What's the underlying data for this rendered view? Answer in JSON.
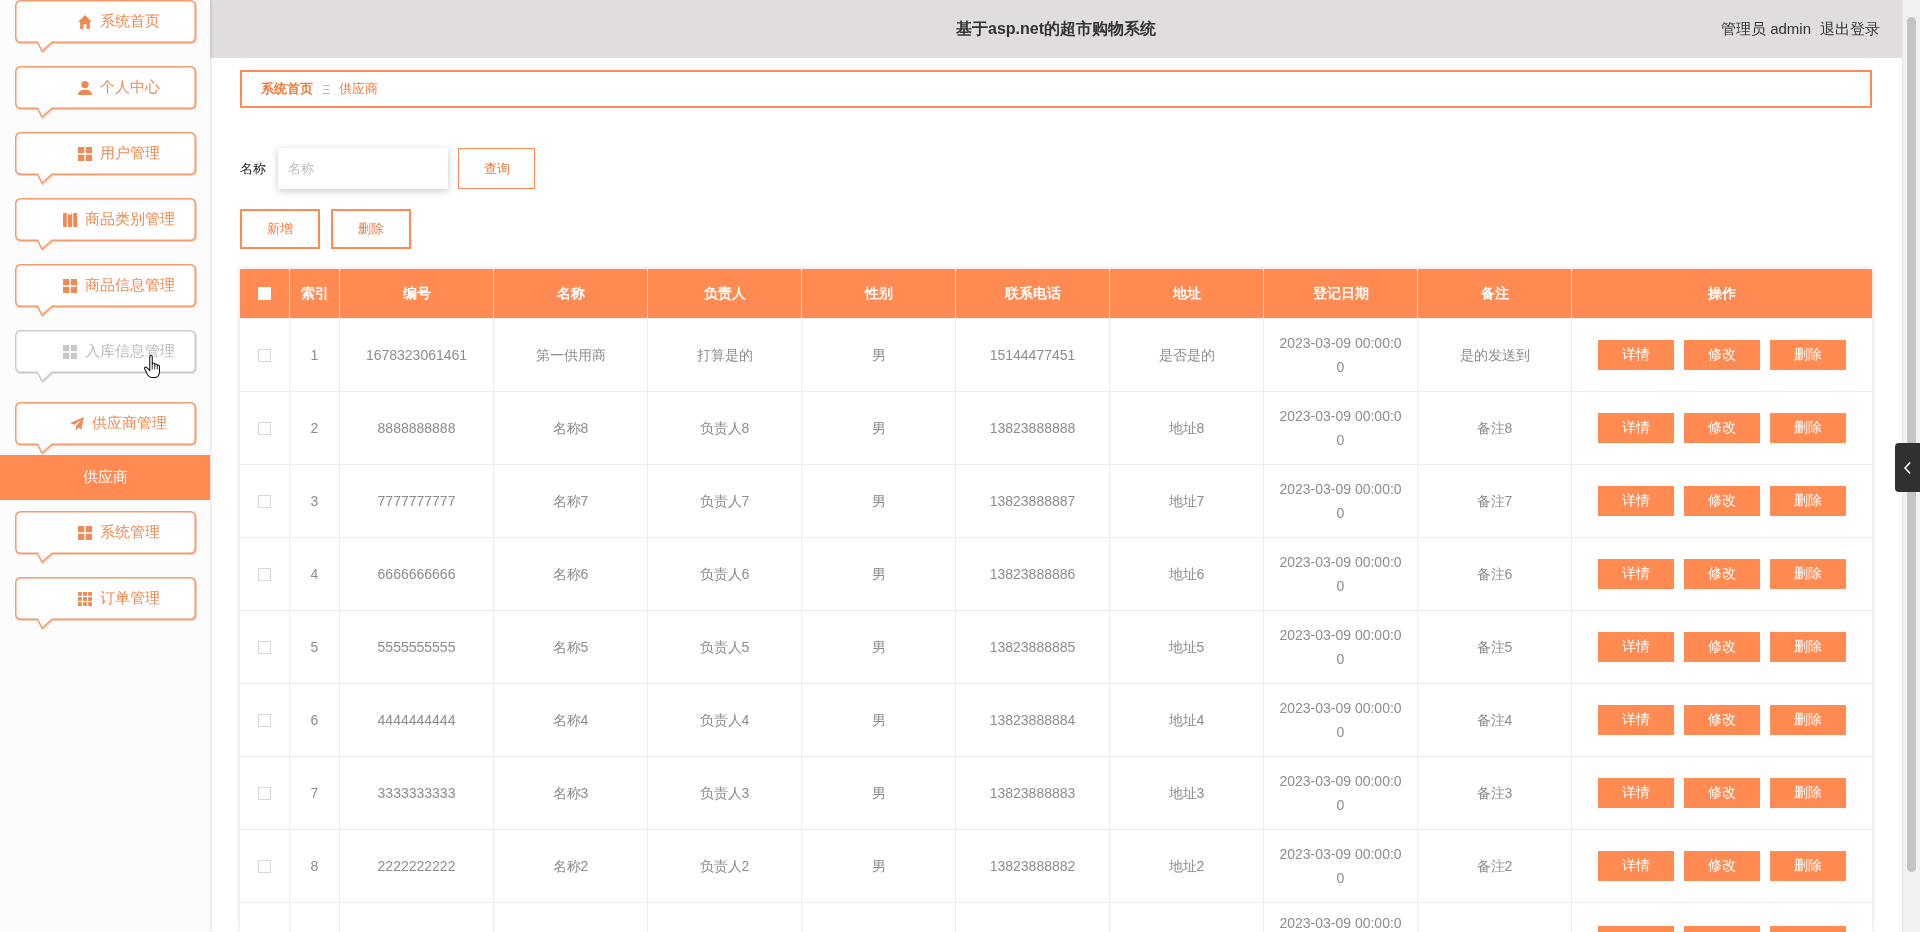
{
  "sidebar": {
    "items": [
      {
        "label": "系统首页",
        "hovered": false
      },
      {
        "label": "个人中心",
        "hovered": false
      },
      {
        "label": "用户管理",
        "hovered": false
      },
      {
        "label": "商品类别管理",
        "hovered": false
      },
      {
        "label": "商品信息管理",
        "hovered": false
      },
      {
        "label": "入库信息管理",
        "hovered": true
      },
      {
        "label": "供应商管理",
        "hovered": false,
        "expanded": true,
        "children": [
          {
            "label": "供应商",
            "selected": true
          }
        ]
      },
      {
        "label": "系统管理",
        "hovered": false
      },
      {
        "label": "订单管理",
        "hovered": false
      }
    ]
  },
  "header": {
    "title": "基于asp.net的超市购物系统",
    "user": "管理员 admin",
    "logout": "退出登录"
  },
  "breadcrumb": {
    "items": [
      {
        "label": "系统首页",
        "current": false
      },
      {
        "label": "供应商",
        "current": true
      }
    ],
    "separator": "Ξ"
  },
  "search": {
    "label": "名称",
    "placeholder": "名称",
    "button": "查询"
  },
  "toolbar": {
    "buttons": [
      "新增",
      "删除"
    ]
  },
  "table": {
    "header_checked": false,
    "columns": [
      "索引",
      "编号",
      "名称",
      "负责人",
      "性别",
      "联系电话",
      "地址",
      "登记日期",
      "备注",
      "操作"
    ],
    "rows": [
      {
        "checked": false,
        "cells": [
          "1",
          "1678323061461",
          "第一供用商",
          "打算是的",
          "男",
          "15144477451",
          "是否是的",
          "2023-03-09 00:00:00",
          "是的发送到"
        ],
        "actions": [
          "详情",
          "修改",
          "删除"
        ]
      },
      {
        "checked": false,
        "cells": [
          "2",
          "8888888888",
          "名称8",
          "负责人8",
          "男",
          "13823888888",
          "地址8",
          "2023-03-09 00:00:00",
          "备注8"
        ],
        "actions": [
          "详情",
          "修改",
          "删除"
        ]
      },
      {
        "checked": false,
        "cells": [
          "3",
          "7777777777",
          "名称7",
          "负责人7",
          "男",
          "13823888887",
          "地址7",
          "2023-03-09 00:00:00",
          "备注7"
        ],
        "actions": [
          "详情",
          "修改",
          "删除"
        ]
      },
      {
        "checked": false,
        "cells": [
          "4",
          "6666666666",
          "名称6",
          "负责人6",
          "男",
          "13823888886",
          "地址6",
          "2023-03-09 00:00:00",
          "备注6"
        ],
        "actions": [
          "详情",
          "修改",
          "删除"
        ]
      },
      {
        "checked": false,
        "cells": [
          "5",
          "5555555555",
          "名称5",
          "负责人5",
          "男",
          "13823888885",
          "地址5",
          "2023-03-09 00:00:00",
          "备注5"
        ],
        "actions": [
          "详情",
          "修改",
          "删除"
        ]
      },
      {
        "checked": false,
        "cells": [
          "6",
          "4444444444",
          "名称4",
          "负责人4",
          "男",
          "13823888884",
          "地址4",
          "2023-03-09 00:00:00",
          "备注4"
        ],
        "actions": [
          "详情",
          "修改",
          "删除"
        ]
      },
      {
        "checked": false,
        "cells": [
          "7",
          "3333333333",
          "名称3",
          "负责人3",
          "男",
          "13823888883",
          "地址3",
          "2023-03-09 00:00:00",
          "备注3"
        ],
        "actions": [
          "详情",
          "修改",
          "删除"
        ]
      },
      {
        "checked": false,
        "cells": [
          "8",
          "2222222222",
          "名称2",
          "负责人2",
          "男",
          "13823888882",
          "地址2",
          "2023-03-09 00:00:00",
          "备注2"
        ],
        "actions": [
          "详情",
          "修改",
          "删除"
        ]
      }
    ],
    "partial_row": {
      "date": "2023-03-09 00:00:0"
    }
  }
}
